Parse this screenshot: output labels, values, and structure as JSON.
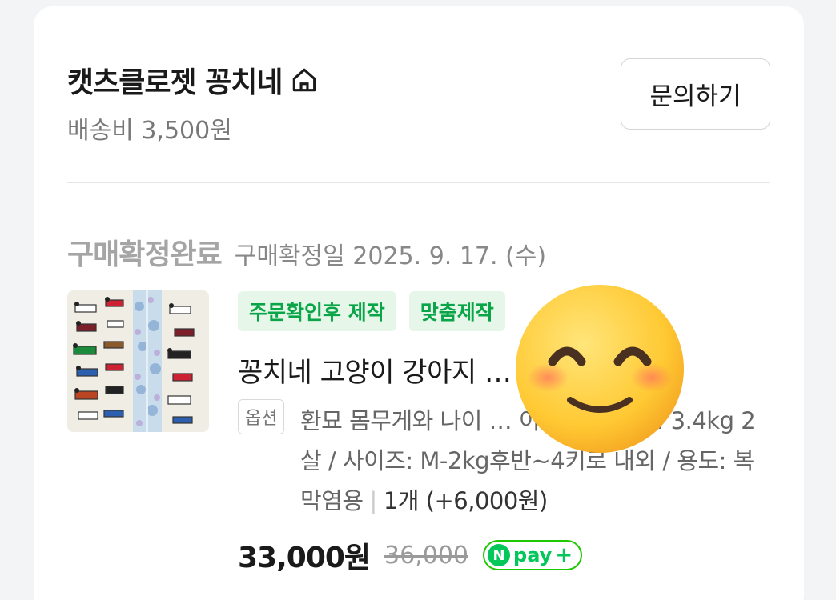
{
  "seller": {
    "name": "캣츠클로젯 꽁치네",
    "shipping": "배송비 3,500원",
    "inquiry_label": "문의하기"
  },
  "order": {
    "status": "구매확정완료",
    "confirm_date": "구매확정일 2025. 9. 17. (수)"
  },
  "product": {
    "tags": [
      "주문확인후 제작",
      "맞춤제작"
    ],
    "title": "꽁치네 고양이 강아지 … 포대기 …",
    "option_badge": "옵션",
    "option_text": "환묘 몸무게와 나이 … 이 됩니다^^): 3.4kg 2살 / 사이즈: M-2kg후반~4키로 내외 / 용도: 복막염용",
    "quantity": "1개 (+6,000원)",
    "price": "33,000원",
    "original_price": "36,000",
    "pay_badge": "pay"
  },
  "icons": {
    "home": "home-icon",
    "npay": "npay-plus-badge",
    "emoji": "smiling-face-emoji"
  },
  "colors": {
    "tag_green": "#0aa548",
    "tag_bg": "#e6f7e9",
    "npay_green": "#03c75a"
  }
}
